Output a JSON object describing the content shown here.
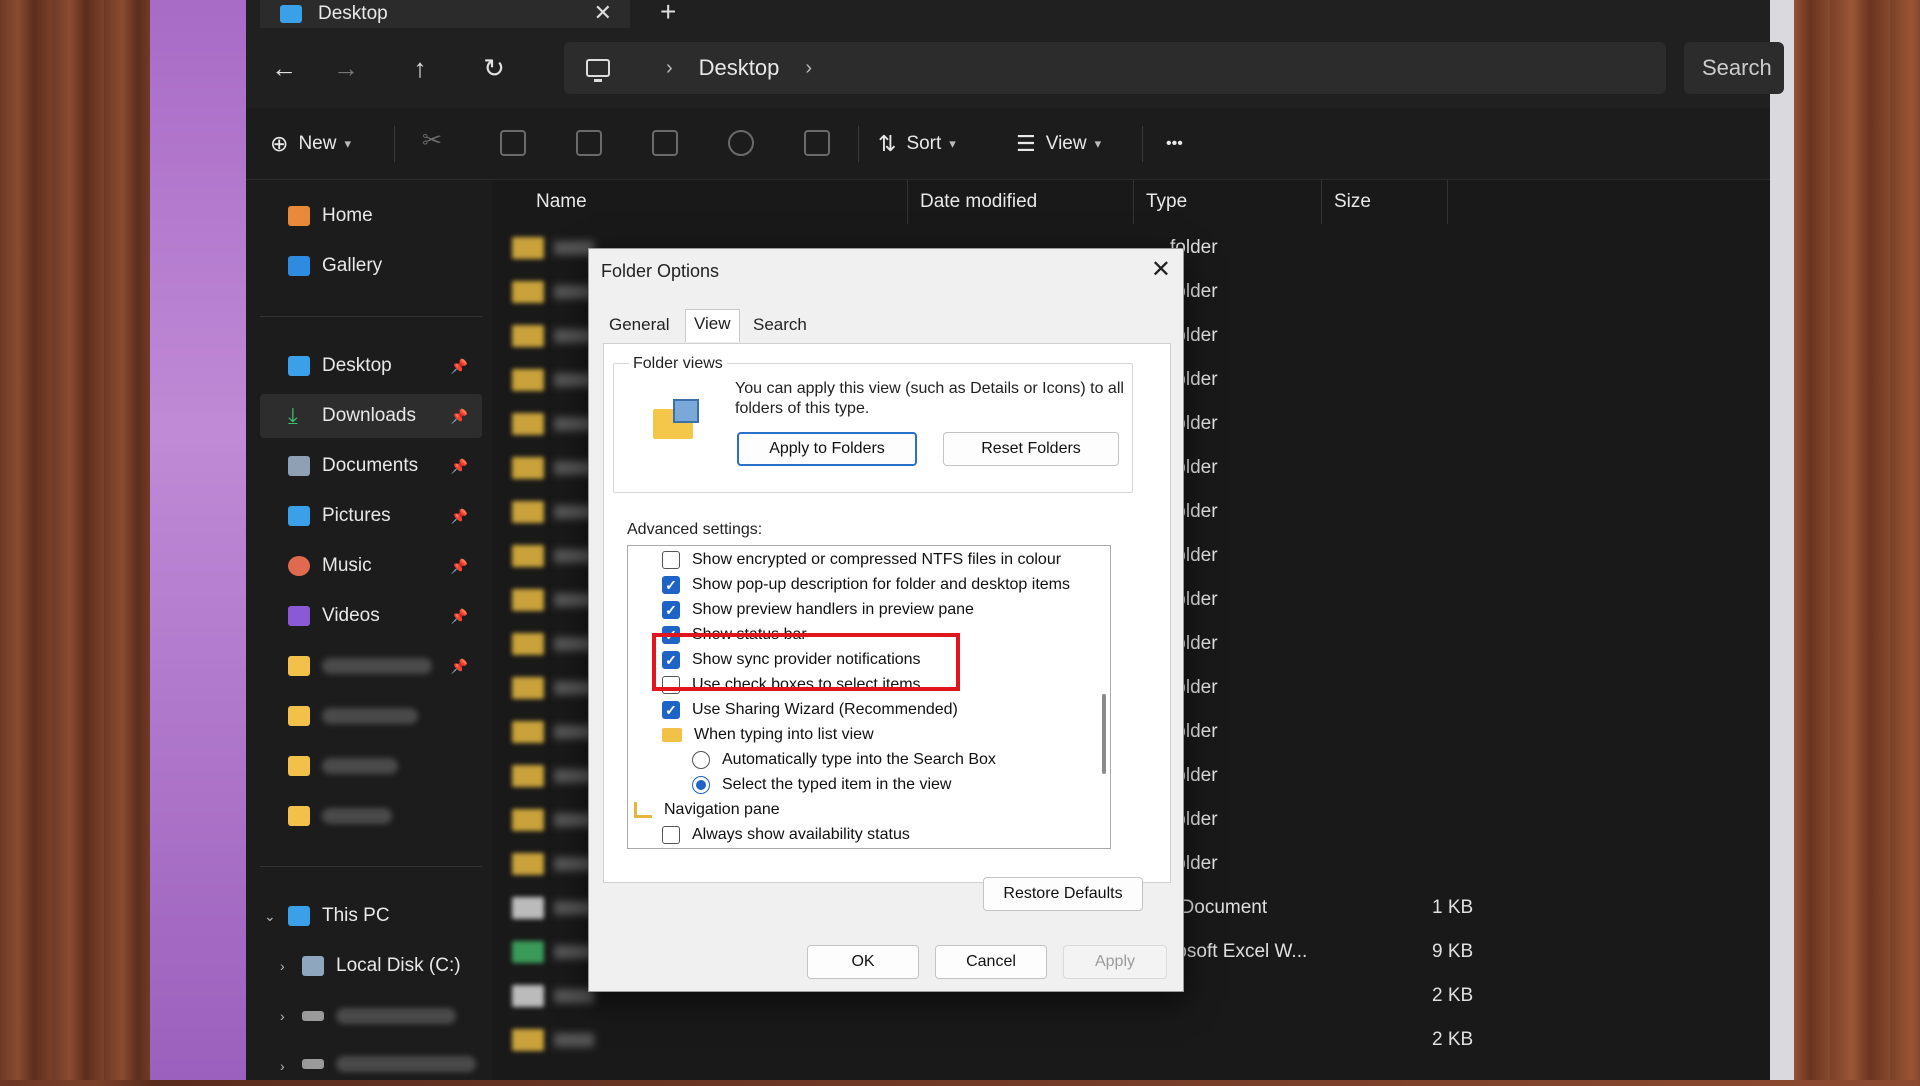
{
  "window": {
    "tab_title": "Desktop",
    "tab_close": "✕",
    "new_tab": "+"
  },
  "address": {
    "back": "←",
    "forward": "→",
    "up": "↑",
    "refresh": "↻",
    "crumb": "Desktop",
    "search_placeholder": "Search"
  },
  "toolbar": {
    "new_label": "New",
    "sort_label": "Sort",
    "view_label": "View",
    "more": "•••"
  },
  "sidebar": {
    "home": "Home",
    "gallery": "Gallery",
    "desktop": "Desktop",
    "downloads": "Downloads",
    "documents": "Documents",
    "pictures": "Pictures",
    "music": "Music",
    "videos": "Videos",
    "this_pc": "This PC",
    "local_disk": "Local Disk (C:)"
  },
  "columns": {
    "name": "Name",
    "date": "Date modified",
    "type": "Type",
    "size": "Size"
  },
  "files": {
    "folder_type": "folder",
    "text_doc": "t Document",
    "excel": "rosoft Excel W...",
    "size_1": "1 KB",
    "size_9": "9 KB",
    "size_2a": "2 KB",
    "size_2b": "2 KB"
  },
  "dialog": {
    "title": "Folder Options",
    "close": "✕",
    "tabs": [
      "General",
      "View",
      "Search"
    ],
    "folder_views_label": "Folder views",
    "folder_views_text": "You can apply this view (such as Details or Icons) to all folders of this type.",
    "apply_folders": "Apply to Folders",
    "reset_folders": "Reset Folders",
    "advanced_label": "Advanced settings:",
    "settings": [
      "Show encrypted or compressed NTFS files in colour",
      "Show pop-up description for folder and desktop items",
      "Show preview handlers in preview pane",
      "Show status bar",
      "Show sync provider notifications",
      "Use check boxes to select items",
      "Use Sharing Wizard (Recommended)",
      "When typing into list view",
      "Automatically type into the Search Box",
      "Select the typed item in the view",
      "Navigation pane",
      "Always show availability status"
    ],
    "restore_defaults": "Restore Defaults",
    "ok": "OK",
    "cancel": "Cancel",
    "apply": "Apply"
  },
  "colors": {
    "accent": "#1f63c6",
    "highlight": "#e0161d"
  }
}
